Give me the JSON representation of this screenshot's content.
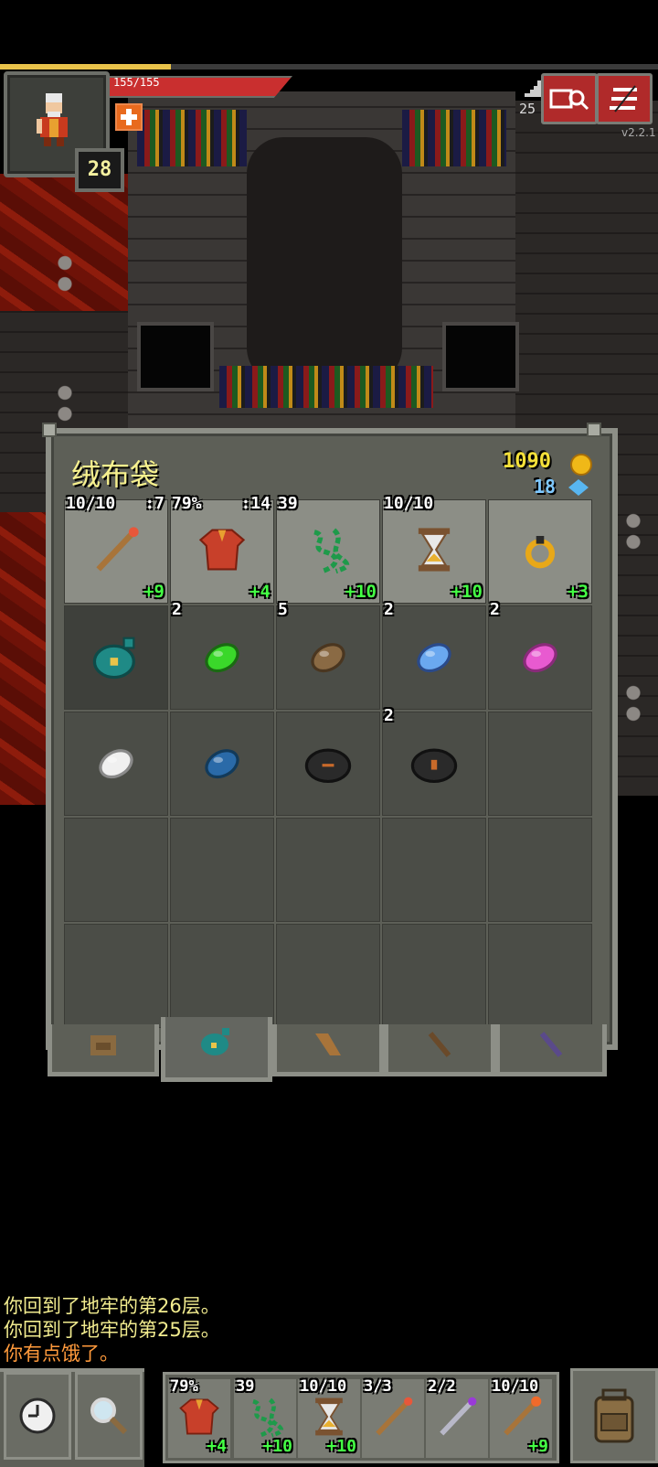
{
  "hud": {
    "hp_text": "155/155",
    "hp_fraction": 1.0,
    "xp_fraction": 0.26,
    "hero_level": "28",
    "depth": "25",
    "version": "v2.2.1"
  },
  "bag": {
    "title": "绒布袋",
    "gold": "1090",
    "energy": "18",
    "slots": [
      {
        "top": "10/10",
        "top_right": ":7",
        "bottom": "+9",
        "icon": "wand-icon",
        "state": "equipped"
      },
      {
        "top": "79%",
        "top_right": ":14",
        "bottom": "+4",
        "icon": "robe-armor-icon",
        "state": "equipped"
      },
      {
        "top": "39",
        "top_right": "",
        "bottom": "+10",
        "icon": "chain-whip-icon",
        "state": "equipped"
      },
      {
        "top": "10/10",
        "top_right": "",
        "bottom": "+10",
        "icon": "hourglass-icon",
        "state": "equipped"
      },
      {
        "top": "",
        "top_right": "",
        "bottom": "+3",
        "icon": "ring-icon",
        "state": "equipped"
      },
      {
        "top": "",
        "top_right": "",
        "bottom": "",
        "icon": "velvet-pouch-icon",
        "state": "selected"
      },
      {
        "top": "2",
        "top_right": "",
        "bottom": "",
        "icon": "green-seed-icon",
        "state": ""
      },
      {
        "top": "5",
        "top_right": "",
        "bottom": "",
        "icon": "brown-seed-icon",
        "state": ""
      },
      {
        "top": "2",
        "top_right": "",
        "bottom": "",
        "icon": "blue-seed-icon",
        "state": ""
      },
      {
        "top": "2",
        "top_right": "",
        "bottom": "",
        "icon": "pink-seed-icon",
        "state": ""
      },
      {
        "top": "",
        "top_right": "",
        "bottom": "",
        "icon": "white-seed-icon",
        "state": ""
      },
      {
        "top": "",
        "top_right": "",
        "bottom": "",
        "icon": "dark-blue-seed-icon",
        "state": ""
      },
      {
        "top": "",
        "top_right": "",
        "bottom": "",
        "icon": "dark-stone-icon",
        "state": ""
      },
      {
        "top": "2",
        "top_right": "",
        "bottom": "",
        "icon": "unknown-stone-icon",
        "state": ""
      },
      {
        "top": "",
        "top_right": "",
        "bottom": "",
        "icon": "",
        "state": ""
      },
      {
        "top": "",
        "top_right": "",
        "bottom": "",
        "icon": "",
        "state": ""
      },
      {
        "top": "",
        "top_right": "",
        "bottom": "",
        "icon": "",
        "state": ""
      },
      {
        "top": "",
        "top_right": "",
        "bottom": "",
        "icon": "",
        "state": ""
      },
      {
        "top": "",
        "top_right": "",
        "bottom": "",
        "icon": "",
        "state": ""
      },
      {
        "top": "",
        "top_right": "",
        "bottom": "",
        "icon": "",
        "state": ""
      },
      {
        "top": "",
        "top_right": "",
        "bottom": "",
        "icon": "",
        "state": ""
      },
      {
        "top": "",
        "top_right": "",
        "bottom": "",
        "icon": "",
        "state": ""
      },
      {
        "top": "",
        "top_right": "",
        "bottom": "",
        "icon": "",
        "state": ""
      },
      {
        "top": "",
        "top_right": "",
        "bottom": "",
        "icon": "",
        "state": ""
      },
      {
        "top": "",
        "top_right": "",
        "bottom": "",
        "icon": "",
        "state": ""
      }
    ],
    "tabs": [
      "backpack-tab-icon",
      "velvet-pouch-tab-icon",
      "scroll-holder-tab-icon",
      "wand-holster-tab-icon",
      "magic-holster-tab-icon"
    ]
  },
  "log": [
    {
      "text": "你回到了地牢的第26层。",
      "color": "#f2ec8f"
    },
    {
      "text": "你回到了地牢的第25层。",
      "color": "#f2ec8f"
    },
    {
      "text": "你有点饿了。",
      "color": "#ff9a3c"
    }
  ],
  "quickslots": [
    {
      "top": "79%",
      "bottom": "+4",
      "icon": "robe-armor-icon"
    },
    {
      "top": "39",
      "bottom": "+10",
      "icon": "chain-whip-icon"
    },
    {
      "top": "10/10",
      "bottom": "+10",
      "icon": "hourglass-icon"
    },
    {
      "top": "3/3",
      "bottom": "",
      "icon": "wand-icon"
    },
    {
      "top": "2/2",
      "bottom": "",
      "icon": "purple-wand-icon"
    },
    {
      "top": "10/10",
      "bottom": "+9",
      "icon": "fire-wand-icon"
    }
  ],
  "colors": {
    "accent_gold": "#f5e13a",
    "upgrade_green": "#44ff44",
    "hud_red": "#b02a2a"
  }
}
